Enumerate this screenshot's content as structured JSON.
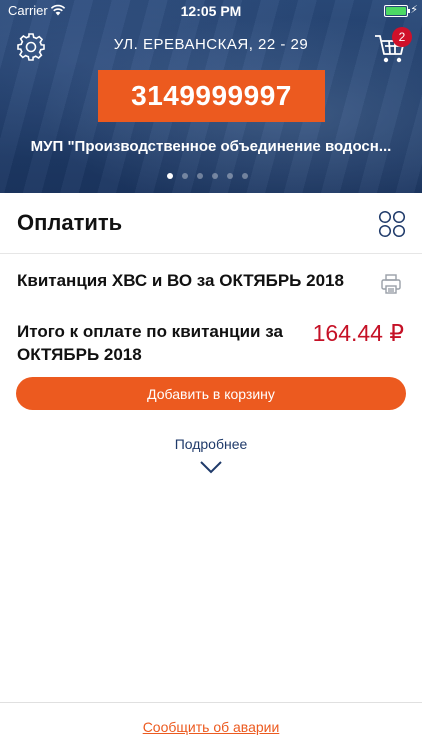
{
  "status_bar": {
    "carrier": "Carrier",
    "time": "12:05 PM"
  },
  "header": {
    "address": "УЛ. ЕРЕВАНСКАЯ, 22 - 29",
    "account_number": "3149999997",
    "organization": "МУП \"Производственное объединение водосн...",
    "cart_count": "2",
    "carousel_pages": 6,
    "carousel_active": 1
  },
  "pay": {
    "title": "Оплатить"
  },
  "receipt": {
    "title": "Квитанция ХВС и ВО за ОКТЯБРЬ 2018",
    "total_label": "Итого к оплате по квитанции за ОКТЯБРЬ 2018",
    "total_amount": "164.44 ₽",
    "add_to_cart_label": "Добавить в корзину",
    "more_label": "Подробнее"
  },
  "footer": {
    "report_label": "Сообщить об аварии"
  },
  "colors": {
    "accent": "#ec5a1f",
    "amount": "#c51126",
    "header_bg": "#203e6c",
    "badge": "#d0102a"
  },
  "icons": [
    "wifi-icon",
    "battery-icon",
    "gear-icon",
    "cart-icon",
    "grid-icon",
    "printer-icon",
    "chevron-down-icon"
  ]
}
